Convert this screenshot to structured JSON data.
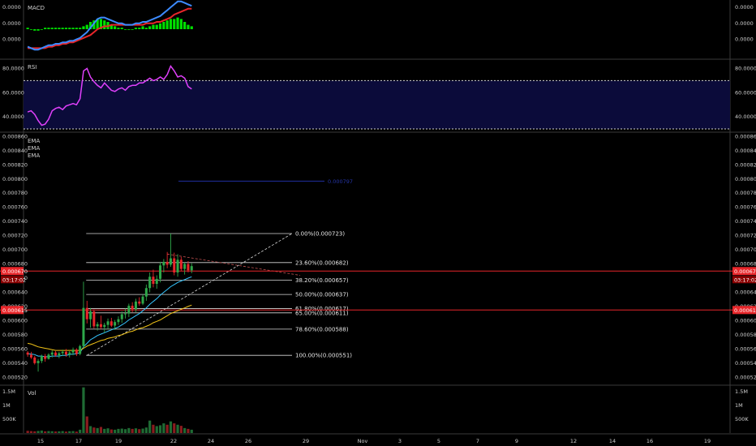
{
  "chart_data": {
    "type": "candlestick",
    "x_axis": {
      "ticks": [
        "15",
        "17",
        "19",
        "22",
        "24",
        "26",
        "29",
        "Nov",
        "3",
        "5",
        "7",
        "9",
        "12",
        "14",
        "16",
        "19"
      ]
    },
    "panes": {
      "macd": {
        "label": "MACD",
        "ylim": [
          -2e-05,
          2e-05
        ],
        "ticks": [
          "0.0000",
          "0.0000",
          "0.0000"
        ],
        "macd_color": "#3d8bff",
        "signal_color": "#e8262a",
        "hist_color": "#00e000",
        "macd": [
          -1.2e-05,
          -1.3e-05,
          -1.4e-05,
          -1.4e-05,
          -1.3e-05,
          -1.2e-05,
          -1.1e-05,
          -1.1e-05,
          -1e-05,
          -1e-05,
          -9e-06,
          -9e-06,
          -8e-06,
          -8e-06,
          -7e-06,
          -6e-06,
          -4e-06,
          -2e-06,
          1e-06,
          4e-06,
          7e-06,
          8e-06,
          8e-06,
          7e-06,
          6e-06,
          5e-06,
          4e-06,
          4e-06,
          3e-06,
          3e-06,
          3e-06,
          4e-06,
          4e-06,
          5e-06,
          5e-06,
          6e-06,
          7e-06,
          8e-06,
          9e-06,
          1.1e-05,
          1.3e-05,
          1.5e-05,
          1.7e-05,
          1.9e-05,
          1.9e-05,
          1.8e-05,
          1.7e-05,
          1.6e-05
        ],
        "signal": [
          -1.3e-05,
          -1.3e-05,
          -1.3e-05,
          -1.3e-05,
          -1.3e-05,
          -1.3e-05,
          -1.2e-05,
          -1.2e-05,
          -1.1e-05,
          -1.1e-05,
          -1e-05,
          -1e-05,
          -9e-06,
          -9e-06,
          -8e-06,
          -7e-06,
          -6e-06,
          -5e-06,
          -4e-06,
          -2e-06,
          0.0,
          1e-06,
          2e-06,
          2e-06,
          3e-06,
          3e-06,
          3e-06,
          3e-06,
          3e-06,
          3e-06,
          3e-06,
          3e-06,
          3e-06,
          3e-06,
          4e-06,
          4e-06,
          4e-06,
          5e-06,
          5e-06,
          6e-06,
          7e-06,
          8e-06,
          1e-05,
          1.1e-05,
          1.2e-05,
          1.3e-05,
          1.4e-05,
          1.4e-05
        ],
        "hist": [
          1e-06,
          0.0,
          -1e-06,
          -1e-06,
          0.0,
          1e-06,
          1e-06,
          1e-06,
          1e-06,
          1e-06,
          1e-06,
          1e-06,
          1e-06,
          1e-06,
          1e-06,
          1e-06,
          2e-06,
          3e-06,
          5e-06,
          6e-06,
          7e-06,
          7e-06,
          6e-06,
          5e-06,
          3e-06,
          2e-06,
          1e-06,
          1e-06,
          0.0,
          0.0,
          0.0,
          1e-06,
          1e-06,
          2e-06,
          1e-06,
          2e-06,
          3e-06,
          3e-06,
          4e-06,
          5e-06,
          6e-06,
          7e-06,
          7e-06,
          8e-06,
          7e-06,
          5e-06,
          3e-06,
          2e-06
        ]
      },
      "rsi": {
        "label": "RSI",
        "ylim": [
          28,
          87
        ],
        "upper_band": 70,
        "lower_band": 30,
        "ticks": [
          "80.0000",
          "60.0000",
          "40.0000"
        ],
        "tick_values": [
          80,
          60,
          40
        ],
        "line_color": "#e040fb",
        "band_fill": "#0b0b3a",
        "values": [
          44,
          45,
          42,
          37,
          33,
          34,
          38,
          45,
          47,
          48,
          46,
          49,
          50,
          51,
          50,
          55,
          78,
          80,
          73,
          69,
          66,
          64,
          68,
          65,
          62,
          61,
          63,
          64,
          62,
          65,
          66,
          66,
          68,
          68,
          70,
          72,
          70,
          71,
          73,
          71,
          75,
          82,
          78,
          73,
          74,
          72,
          65,
          63
        ]
      },
      "price": {
        "label_lines": [
          "EMA",
          "EMA",
          "EMA"
        ],
        "ylim": [
          0.00051,
          0.000865
        ],
        "ticks": [
          "0.000860",
          "0.000840",
          "0.000820",
          "0.000800",
          "0.000780",
          "0.000760",
          "0.000740",
          "0.000720",
          "0.000700",
          "0.000680",
          "0.000660",
          "0.000640",
          "0.000620",
          "0.000600",
          "0.000580",
          "0.000560",
          "0.000540",
          "0.000520"
        ],
        "tick_values": [
          0.00086,
          0.00084,
          0.00082,
          0.0008,
          0.00078,
          0.00076,
          0.00074,
          0.00072,
          0.0007,
          0.00068,
          0.00066,
          0.00064,
          0.00062,
          0.0006,
          0.00058,
          0.00056,
          0.00054,
          0.00052
        ],
        "up_color": "#2ea84a",
        "down_color": "#e8262a",
        "candles": [
          [
            0.000555,
            0.000557,
            0.000549,
            0.000552
          ],
          [
            0.000552,
            0.000556,
            0.000546,
            0.000548
          ],
          [
            0.000548,
            0.00055,
            0.000538,
            0.00054
          ],
          [
            0.00054,
            0.000546,
            0.000528,
            0.000543
          ],
          [
            0.000543,
            0.000552,
            0.00054,
            0.00055
          ],
          [
            0.00055,
            0.000553,
            0.000542,
            0.000546
          ],
          [
            0.000546,
            0.000554,
            0.000545,
            0.000552
          ],
          [
            0.000552,
            0.000558,
            0.000548,
            0.000555
          ],
          [
            0.000555,
            0.000557,
            0.000549,
            0.000551
          ],
          [
            0.000551,
            0.000556,
            0.000547,
            0.000554
          ],
          [
            0.000554,
            0.000559,
            0.00055,
            0.000556
          ],
          [
            0.000556,
            0.00056,
            0.000549,
            0.000552
          ],
          [
            0.000552,
            0.000557,
            0.000548,
            0.000555
          ],
          [
            0.000555,
            0.000562,
            0.000551,
            0.000559
          ],
          [
            0.000559,
            0.000561,
            0.00055,
            0.000553
          ],
          [
            0.000553,
            0.000566,
            0.000551,
            0.000564
          ],
          [
            0.000564,
            0.000655,
            0.000562,
            0.000618
          ],
          [
            0.000618,
            0.000628,
            0.000596,
            0.000602
          ],
          [
            0.000602,
            0.000618,
            0.00059,
            0.000613
          ],
          [
            0.000613,
            0.000616,
            0.000589,
            0.000592
          ],
          [
            0.000592,
            0.000598,
            0.000586,
            0.000595
          ],
          [
            0.000595,
            0.000607,
            0.000588,
            0.000591
          ],
          [
            0.000591,
            0.000597,
            0.000583,
            0.000594
          ],
          [
            0.000594,
            0.000603,
            0.000588,
            0.000599
          ],
          [
            0.000599,
            0.000604,
            0.000591,
            0.000593
          ],
          [
            0.000593,
            0.000601,
            0.000587,
            0.000598
          ],
          [
            0.000598,
            0.000606,
            0.000594,
            0.000602
          ],
          [
            0.000602,
            0.000613,
            0.000597,
            0.000609
          ],
          [
            0.000609,
            0.000617,
            0.000603,
            0.00061
          ],
          [
            0.00061,
            0.000624,
            0.000605,
            0.000621
          ],
          [
            0.000621,
            0.000626,
            0.000612,
            0.000616
          ],
          [
            0.000616,
            0.000631,
            0.000612,
            0.000627
          ],
          [
            0.000627,
            0.000633,
            0.000621,
            0.000624
          ],
          [
            0.000624,
            0.000637,
            0.000622,
            0.000634
          ],
          [
            0.000634,
            0.000651,
            0.000628,
            0.000646
          ],
          [
            0.000646,
            0.000668,
            0.00064,
            0.000662
          ],
          [
            0.000662,
            0.000672,
            0.000647,
            0.000652
          ],
          [
            0.000652,
            0.000664,
            0.000645,
            0.000659
          ],
          [
            0.000659,
            0.000683,
            0.000654,
            0.000678
          ],
          [
            0.000678,
            0.000687,
            0.000668,
            0.000683
          ],
          [
            0.000683,
            0.000697,
            0.000674,
            0.000679
          ],
          [
            0.000679,
            0.000723,
            0.000676,
            0.000688
          ],
          [
            0.000688,
            0.000696,
            0.000664,
            0.000668
          ],
          [
            0.000668,
            0.000694,
            0.000662,
            0.000686
          ],
          [
            0.000686,
            0.00069,
            0.00067,
            0.000673
          ],
          [
            0.000673,
            0.000682,
            0.000665,
            0.00068
          ],
          [
            0.00068,
            0.000684,
            0.000668,
            0.000671
          ],
          [
            0.000671,
            0.000681,
            0.000667,
            0.000677
          ]
        ],
        "ema_lines": [
          {
            "color": "#35c5ff",
            "values": [
              0.000553,
              0.000553,
              0.000552,
              0.00055,
              0.00055,
              0.000549,
              0.000549,
              0.00055,
              0.00055,
              0.00055,
              0.000551,
              0.000551,
              0.000552,
              0.000553,
              0.000553,
              0.000555,
              0.000563,
              0.000568,
              0.000573,
              0.000576,
              0.000579,
              0.000581,
              0.000583,
              0.000585,
              0.000587,
              0.000589,
              0.000591,
              0.000594,
              0.000597,
              0.000601,
              0.000604,
              0.000607,
              0.00061,
              0.000614,
              0.000618,
              0.000623,
              0.000627,
              0.000631,
              0.000636,
              0.00064,
              0.000644,
              0.000648,
              0.000651,
              0.000654,
              0.000656,
              0.000658,
              0.00066,
              0.000662
            ]
          },
          {
            "color": "#f2c418",
            "values": [
              0.000568,
              0.000567,
              0.000565,
              0.000563,
              0.000562,
              0.000561,
              0.00056,
              0.000559,
              0.000558,
              0.000558,
              0.000558,
              0.000558,
              0.000558,
              0.000558,
              0.000558,
              0.000558,
              0.000561,
              0.000564,
              0.000566,
              0.000568,
              0.00057,
              0.000572,
              0.000573,
              0.000575,
              0.000576,
              0.000577,
              0.000579,
              0.00058,
              0.000582,
              0.000584,
              0.000585,
              0.000587,
              0.000589,
              0.00059,
              0.000592,
              0.000594,
              0.000597,
              0.000599,
              0.000601,
              0.000604,
              0.000607,
              0.00061,
              0.000612,
              0.000614,
              0.000616,
              0.000618,
              0.00062,
              0.000622
            ]
          }
        ],
        "current_price": {
          "value": "0.000670",
          "countdown": "03:17:02",
          "line_value": 0.00067
        },
        "level_line": {
          "value": "0.000615",
          "line_value": 0.000615
        },
        "faded_annotation": "0.000797",
        "fibonacci": [
          {
            "label": "0.00%(0.000723)",
            "value": 0.000723
          },
          {
            "label": "23.60%(0.000682)",
            "value": 0.000682
          },
          {
            "label": "38.20%(0.000657)",
            "value": 0.000657
          },
          {
            "label": "50.00%(0.000637)",
            "value": 0.000637
          },
          {
            "label": "61.80%(0.000617)",
            "value": 0.000617
          },
          {
            "label": "65.00%(0.000611)",
            "value": 0.000611
          },
          {
            "label": "78.60%(0.000588)",
            "value": 0.000588
          },
          {
            "label": "100.00%(0.000551)",
            "value": 0.000551
          }
        ]
      },
      "volume": {
        "label": "Vol",
        "ylim": [
          0,
          1700000
        ],
        "ticks": [
          "1.5M",
          "1M",
          "500K"
        ],
        "tick_values": [
          1500000,
          1000000,
          500000
        ],
        "values": [
          80000,
          70000,
          60000,
          75000,
          90000,
          60000,
          70000,
          65000,
          55000,
          60000,
          70000,
          50000,
          65000,
          70000,
          50000,
          120000,
          1650000,
          600000,
          250000,
          200000,
          180000,
          220000,
          150000,
          170000,
          130000,
          120000,
          150000,
          160000,
          140000,
          180000,
          150000,
          170000,
          140000,
          160000,
          200000,
          450000,
          300000,
          250000,
          280000,
          350000,
          300000,
          420000,
          350000,
          300000,
          260000,
          180000,
          150000,
          120000
        ]
      }
    }
  }
}
